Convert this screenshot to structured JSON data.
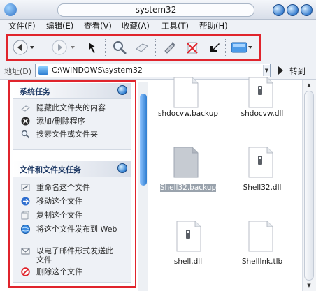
{
  "window": {
    "title": "system32",
    "controls": [
      "minimize",
      "maximize",
      "close"
    ]
  },
  "menu": [
    "文件(F)",
    "编辑(E)",
    "查看(V)",
    "收藏(A)",
    "工具(T)",
    "帮助(H)"
  ],
  "toolbar": {
    "icons": [
      "back-arrow-icon",
      "forward-arrow-icon",
      "up-folder-icon",
      "search-icon",
      "folders-icon",
      "move-to-icon",
      "delete-icon",
      "undo-icon",
      "views-icon"
    ]
  },
  "address": {
    "label": "地址(D)",
    "path": "C:\\WINDOWS\\system32",
    "go_label": "转到"
  },
  "task_pane": {
    "groups": [
      {
        "title": "系统任务",
        "items": [
          {
            "label": "隐藏此文件夹的内容",
            "icon": "hide-icon"
          },
          {
            "label": "添加/删除程序",
            "icon": "add-remove-icon"
          },
          {
            "label": "搜索文件或文件夹",
            "icon": "search-icon"
          }
        ]
      },
      {
        "title": "文件和文件夹任务",
        "items": [
          {
            "label": "重命名这个文件",
            "icon": "rename-icon"
          },
          {
            "label": "移动这个文件",
            "icon": "move-icon"
          },
          {
            "label": "复制这个文件",
            "icon": "copy-icon"
          },
          {
            "label": "将这个文件发布到 Web",
            "icon": "publish-web-icon"
          },
          {
            "label": "以电子邮件形式发送此文件",
            "icon": "email-icon"
          },
          {
            "label": "删除这个文件",
            "icon": "delete-icon"
          }
        ]
      }
    ]
  },
  "files": [
    {
      "name": "shdocvw.backup",
      "icon": "generic-file-icon",
      "selected": false
    },
    {
      "name": "shdocvw.dll",
      "icon": "dll-file-icon",
      "selected": false
    },
    {
      "name": "Shell32.backup",
      "icon": "generic-file-icon",
      "selected": true
    },
    {
      "name": "Shell32.dll",
      "icon": "dll-file-icon",
      "selected": false
    },
    {
      "name": "shell.dll",
      "icon": "dll-file-icon",
      "selected": false
    },
    {
      "name": "Shelllnk.tlb",
      "icon": "generic-file-icon",
      "selected": false
    }
  ],
  "colors": {
    "highlight_border": "#e0242c",
    "accent": "#2f7ed1",
    "selection": "#9aa3ad"
  }
}
